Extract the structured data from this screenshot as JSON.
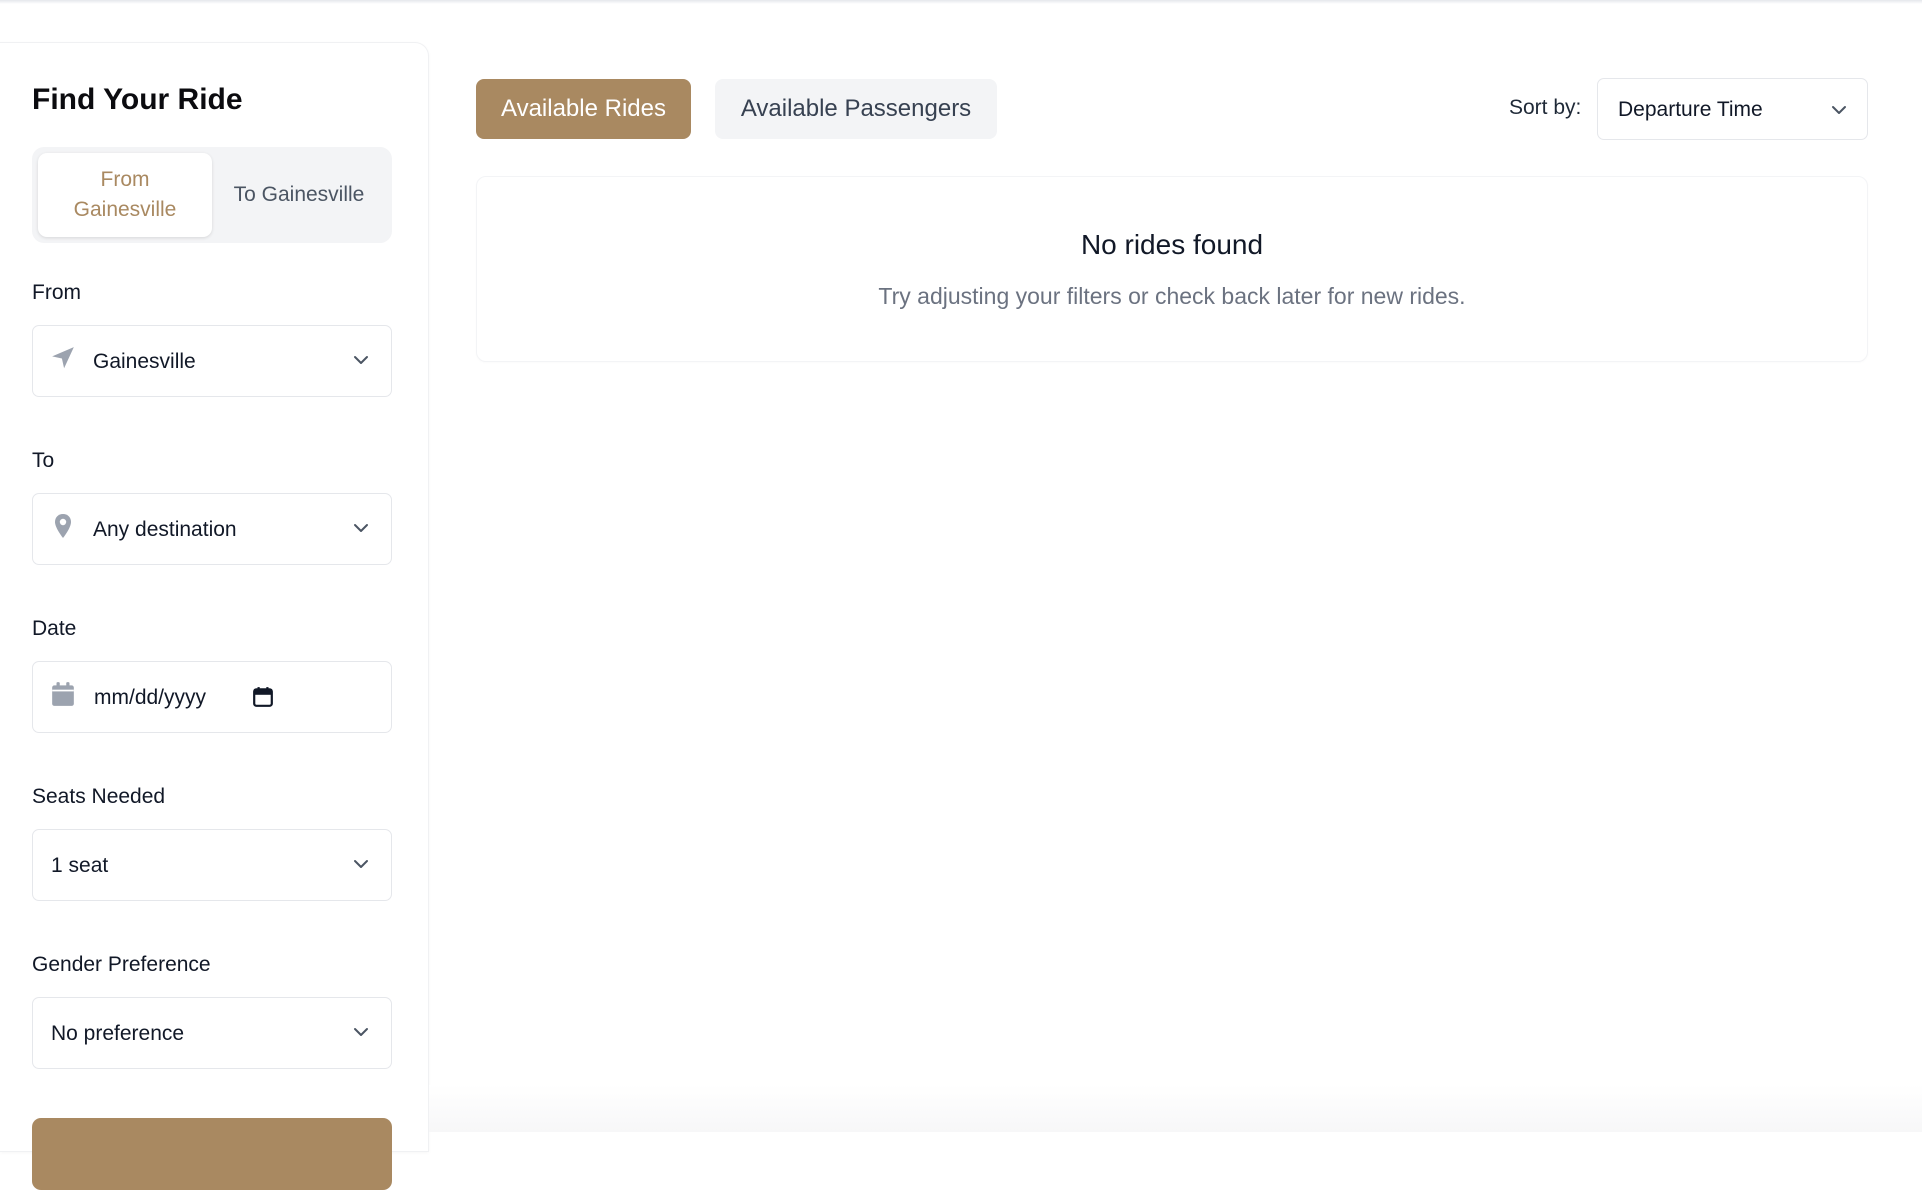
{
  "sidebar": {
    "title": "Find Your Ride",
    "direction": {
      "active_label": "From Gainesville",
      "other_label": "To Gainesville"
    },
    "from": {
      "label": "From",
      "value": "Gainesville",
      "icon": "navigation-arrow-icon"
    },
    "to": {
      "label": "To",
      "value": "Any destination",
      "icon": "map-pin-icon"
    },
    "date": {
      "label": "Date",
      "placeholder": "mm/dd/yyyy",
      "icon": "calendar-icon"
    },
    "seats": {
      "label": "Seats Needed",
      "value": "1 seat"
    },
    "gender": {
      "label": "Gender Preference",
      "value": "No preference"
    }
  },
  "main": {
    "tabs": [
      {
        "label": "Available Rides",
        "active": true
      },
      {
        "label": "Available Passengers",
        "active": false
      }
    ],
    "sort": {
      "label": "Sort by:",
      "value": "Departure Time"
    },
    "empty_state": {
      "title": "No rides found",
      "subtitle": "Try adjusting your filters or check back later for new rides."
    }
  },
  "colors": {
    "accent": "#a98961",
    "muted_text": "#6b7280",
    "icon_gray": "#9ca3af"
  }
}
